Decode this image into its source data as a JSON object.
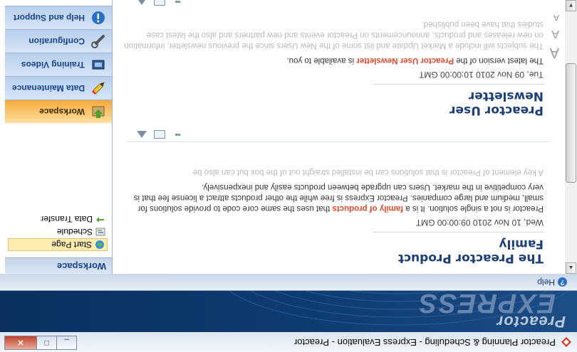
{
  "window": {
    "title": "Preactor Planning & Scheduling - Express Evaluation - Preactor",
    "minimize_glyph": "_",
    "maximize_glyph": "□",
    "close_glyph": "✕"
  },
  "banner": {
    "brand_top": "Preactor",
    "brand_main": "EXPRESS"
  },
  "help": {
    "label": "Help",
    "icon": "question-icon"
  },
  "nav": {
    "section_title": "Workspace",
    "links": [
      {
        "label": "Start Page",
        "icon": "globe-icon",
        "selected": true
      },
      {
        "label": "Schedule",
        "icon": "schedule-icon",
        "selected": false
      },
      {
        "label": "Data Transfer",
        "icon": "transfer-icon",
        "selected": false
      }
    ],
    "buttons": [
      {
        "label": "Workspace",
        "icon": "workspace-icon",
        "active": true
      },
      {
        "label": "Data Maintenance",
        "icon": "pencil-icon",
        "active": false
      },
      {
        "label": "Training Videos",
        "icon": "film-icon",
        "active": false
      },
      {
        "label": "Configuration",
        "icon": "wrench-icon",
        "active": false
      },
      {
        "label": "Help and Support",
        "icon": "info-icon",
        "active": false
      }
    ]
  },
  "articles": [
    {
      "title": "The Preactor Product Family",
      "date": "Wed, 10 Nov 2010 09:00:00 GMT",
      "p1_before": "Preactor is not a single solution.  It is a ",
      "p1_link": "family of products",
      "p1_after": " that uses the same core code to provide solutions for small, medium and large companies. Preactor Express is free while the other products attract a license fee that is very competitive in the market. Users can upgrade between products easily and inexpensively.",
      "p2": "A key element of Preactor is that solutions can be installed straight out of the box but can also be"
    },
    {
      "title": "Preactor User Newsletter",
      "date": "Tue, 09 Nov 2010 10:00:00 GMT",
      "p1_before": "The latest version of the ",
      "p1_link": "Preactor User Newsletter",
      "p1_after": " is available to you.",
      "p2": "The subjects will include a Market Update and list some of the New Users since the previous newsletter, information on new releases and products, announcements on Preactor events and new partners and also the latest case studies that have been published."
    }
  ],
  "font_control": {
    "glyph": "A"
  },
  "colors": {
    "accent": "#15428b",
    "link": "#e04a2b",
    "active_tab": "#f5a93a"
  }
}
